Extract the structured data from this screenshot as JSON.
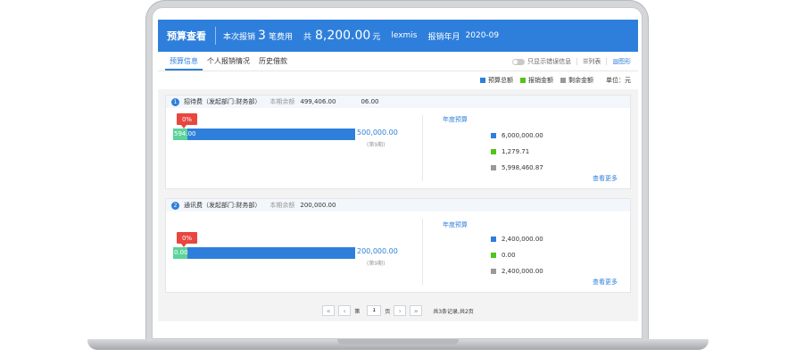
{
  "header": {
    "title": "预算查看",
    "report_prefix": "本次报销",
    "report_count": "3",
    "report_suffix": "笔费用",
    "total_prefix": "共",
    "total_amount": "8,200.00",
    "total_unit": "元",
    "user": "lexmis",
    "period_label": "报销年月",
    "period_value": "2020-09"
  },
  "tabs": [
    {
      "label": "预算信息"
    },
    {
      "label": "个人报销情况"
    },
    {
      "label": "历史借款"
    }
  ],
  "toolbar": {
    "error_only_label": "只显示错误信息",
    "list_label": "列表",
    "chart_label": "图形"
  },
  "legend": {
    "total": "预算总额",
    "reimbursed": "报销金额",
    "remaining": "剩余金额",
    "unit": "单位：元",
    "colors": {
      "total": "#2e7fdb",
      "reimbursed": "#52c41a",
      "remaining": "#999999"
    }
  },
  "cards": [
    {
      "index": "1",
      "name": "招待费（发起部门:财务部）",
      "balance_label": "本期余额",
      "balance_value": "499,406.00",
      "extra_value": "06.00",
      "percent": "0%",
      "fill_text": "594.00",
      "fill_fraction": 0.0012,
      "amount": "500,000.00",
      "period": "(第9期)",
      "year_label": "年度预算",
      "stat_total": "6,000,000.00",
      "stat_reimbursed": "1,279.71",
      "stat_remaining": "5,998,460.87",
      "more": "查看更多"
    },
    {
      "index": "2",
      "name": "通讯费（发起部门:财务部）",
      "balance_label": "本期余额",
      "balance_value": "200,000.00",
      "extra_value": "",
      "percent": "0%",
      "fill_text": "0.00",
      "fill_fraction": 0,
      "amount": "200,000.00",
      "period": "(第9期)",
      "year_label": "年度预算",
      "stat_total": "2,400,000.00",
      "stat_reimbursed": "0.00",
      "stat_remaining": "2,400,000.00",
      "more": "查看更多"
    }
  ],
  "pager": {
    "page_prefix": "第",
    "page_value": "1",
    "page_suffix": "页",
    "info": "共3条记录,共2页"
  }
}
